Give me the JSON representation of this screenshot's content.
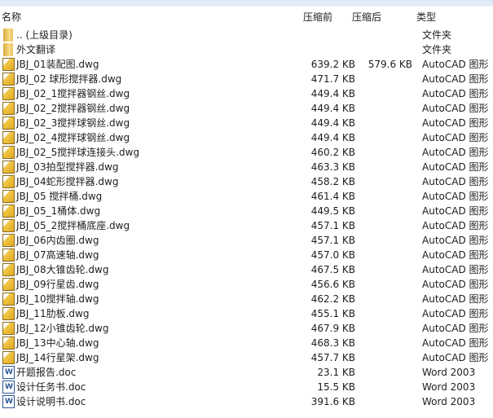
{
  "header": {
    "name": "名称",
    "before": "压缩前",
    "after": "压缩后",
    "type": "类型"
  },
  "rows": [
    {
      "icon": "folder",
      "name": ".. (上级目录)",
      "before": "",
      "after": "",
      "type": "文件夹"
    },
    {
      "icon": "folder",
      "name": "外文翻译",
      "before": "",
      "after": "",
      "type": "文件夹"
    },
    {
      "icon": "dwg",
      "name": "JBJ_01装配图.dwg",
      "before": "639.2 KB",
      "after": "579.6 KB",
      "type": "AutoCAD 图形"
    },
    {
      "icon": "dwg",
      "name": "JBJ_02 球形搅拌器.dwg",
      "before": "471.7 KB",
      "after": "",
      "type": "AutoCAD 图形"
    },
    {
      "icon": "dwg",
      "name": "JBJ_02_1搅拌器钢丝.dwg",
      "before": "449.4 KB",
      "after": "",
      "type": "AutoCAD 图形"
    },
    {
      "icon": "dwg",
      "name": "JBJ_02_2搅拌器钢丝.dwg",
      "before": "449.4 KB",
      "after": "",
      "type": "AutoCAD 图形"
    },
    {
      "icon": "dwg",
      "name": "JBJ_02_3搅拌球钢丝.dwg",
      "before": "449.4 KB",
      "after": "",
      "type": "AutoCAD 图形"
    },
    {
      "icon": "dwg",
      "name": "JBJ_02_4搅拌球钢丝.dwg",
      "before": "449.4 KB",
      "after": "",
      "type": "AutoCAD 图形"
    },
    {
      "icon": "dwg",
      "name": "JBJ_02_5搅拌球连接头.dwg",
      "before": "460.2 KB",
      "after": "",
      "type": "AutoCAD 图形"
    },
    {
      "icon": "dwg",
      "name": "JBJ_03拍型搅拌器.dwg",
      "before": "463.3 KB",
      "after": "",
      "type": "AutoCAD 图形"
    },
    {
      "icon": "dwg",
      "name": "JBJ_04蛇形搅拌器.dwg",
      "before": "458.2 KB",
      "after": "",
      "type": "AutoCAD 图形"
    },
    {
      "icon": "dwg",
      "name": "JBJ_05 搅拌桶.dwg",
      "before": "461.4 KB",
      "after": "",
      "type": "AutoCAD 图形"
    },
    {
      "icon": "dwg",
      "name": "JBJ_05_1桶体.dwg",
      "before": "449.5 KB",
      "after": "",
      "type": "AutoCAD 图形"
    },
    {
      "icon": "dwg",
      "name": "JBJ_05_2搅拌桶底座.dwg",
      "before": "457.1 KB",
      "after": "",
      "type": "AutoCAD 图形"
    },
    {
      "icon": "dwg",
      "name": "JBJ_06内齿圈.dwg",
      "before": "457.1 KB",
      "after": "",
      "type": "AutoCAD 图形"
    },
    {
      "icon": "dwg",
      "name": "JBJ_07高速轴.dwg",
      "before": "457.0 KB",
      "after": "",
      "type": "AutoCAD 图形"
    },
    {
      "icon": "dwg",
      "name": "JBJ_08大锥齿轮.dwg",
      "before": "467.5 KB",
      "after": "",
      "type": "AutoCAD 图形"
    },
    {
      "icon": "dwg",
      "name": "JBJ_09行星齿.dwg",
      "before": "456.6 KB",
      "after": "",
      "type": "AutoCAD 图形"
    },
    {
      "icon": "dwg",
      "name": "JBJ_10搅拌轴.dwg",
      "before": "462.2 KB",
      "after": "",
      "type": "AutoCAD 图形"
    },
    {
      "icon": "dwg",
      "name": "JBJ_11肋板.dwg",
      "before": "455.1 KB",
      "after": "",
      "type": "AutoCAD 图形"
    },
    {
      "icon": "dwg",
      "name": "JBJ_12小锥齿轮.dwg",
      "before": "467.9 KB",
      "after": "",
      "type": "AutoCAD 图形"
    },
    {
      "icon": "dwg",
      "name": "JBJ_13中心轴.dwg",
      "before": "468.3 KB",
      "after": "",
      "type": "AutoCAD 图形"
    },
    {
      "icon": "dwg",
      "name": "JBJ_14行星架.dwg",
      "before": "457.7 KB",
      "after": "",
      "type": "AutoCAD 图形"
    },
    {
      "icon": "doc",
      "name": "开题报告.doc",
      "before": "23.1 KB",
      "after": "",
      "type": "Word 2003"
    },
    {
      "icon": "doc",
      "name": "设计任务书.doc",
      "before": "15.5 KB",
      "after": "",
      "type": "Word 2003"
    },
    {
      "icon": "doc",
      "name": "设计说明书.doc",
      "before": "391.6 KB",
      "after": "",
      "type": "Word 2003"
    }
  ]
}
